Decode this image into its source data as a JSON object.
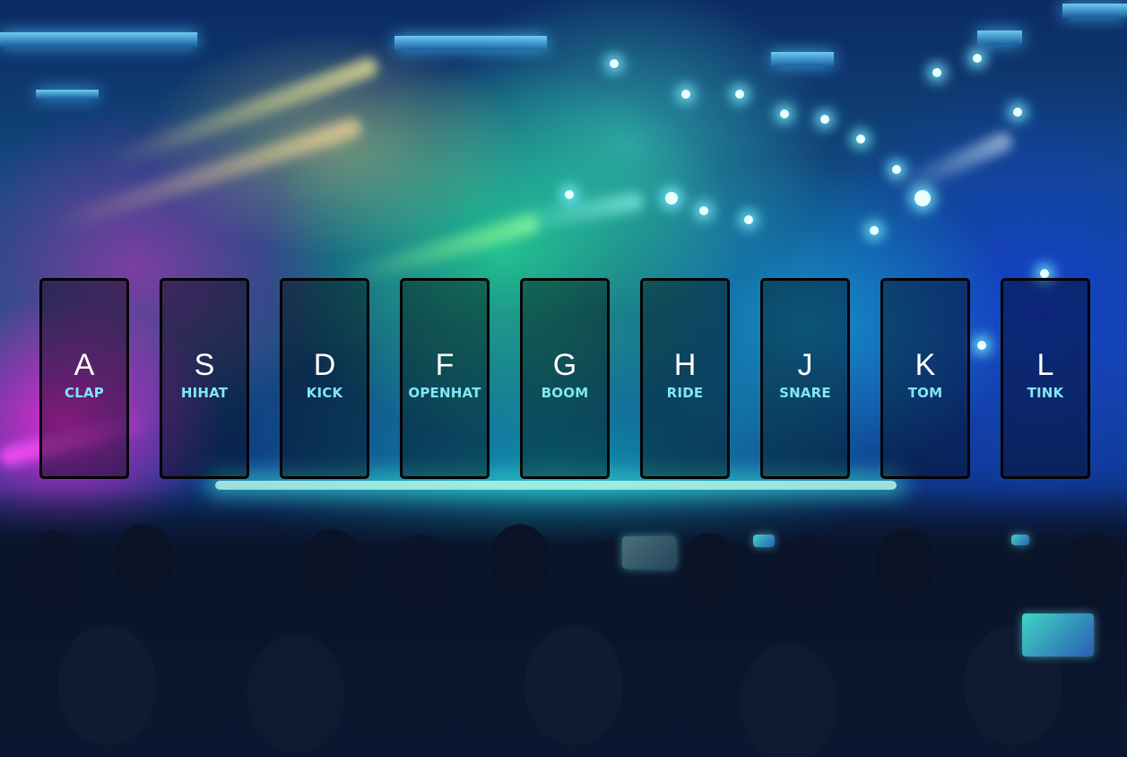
{
  "background": {
    "description_icon": "concert-crowd-photo"
  },
  "colors": {
    "key_letter": "#ffffff",
    "key_sound": "#7fe7f5",
    "key_border": "#000000"
  },
  "keys": [
    {
      "letter": "A",
      "sound": "CLAP"
    },
    {
      "letter": "S",
      "sound": "HIHAT"
    },
    {
      "letter": "D",
      "sound": "KICK"
    },
    {
      "letter": "F",
      "sound": "OPENHAT"
    },
    {
      "letter": "G",
      "sound": "BOOM"
    },
    {
      "letter": "H",
      "sound": "RIDE"
    },
    {
      "letter": "J",
      "sound": "SNARE"
    },
    {
      "letter": "K",
      "sound": "TOM"
    },
    {
      "letter": "L",
      "sound": "TINK"
    }
  ]
}
